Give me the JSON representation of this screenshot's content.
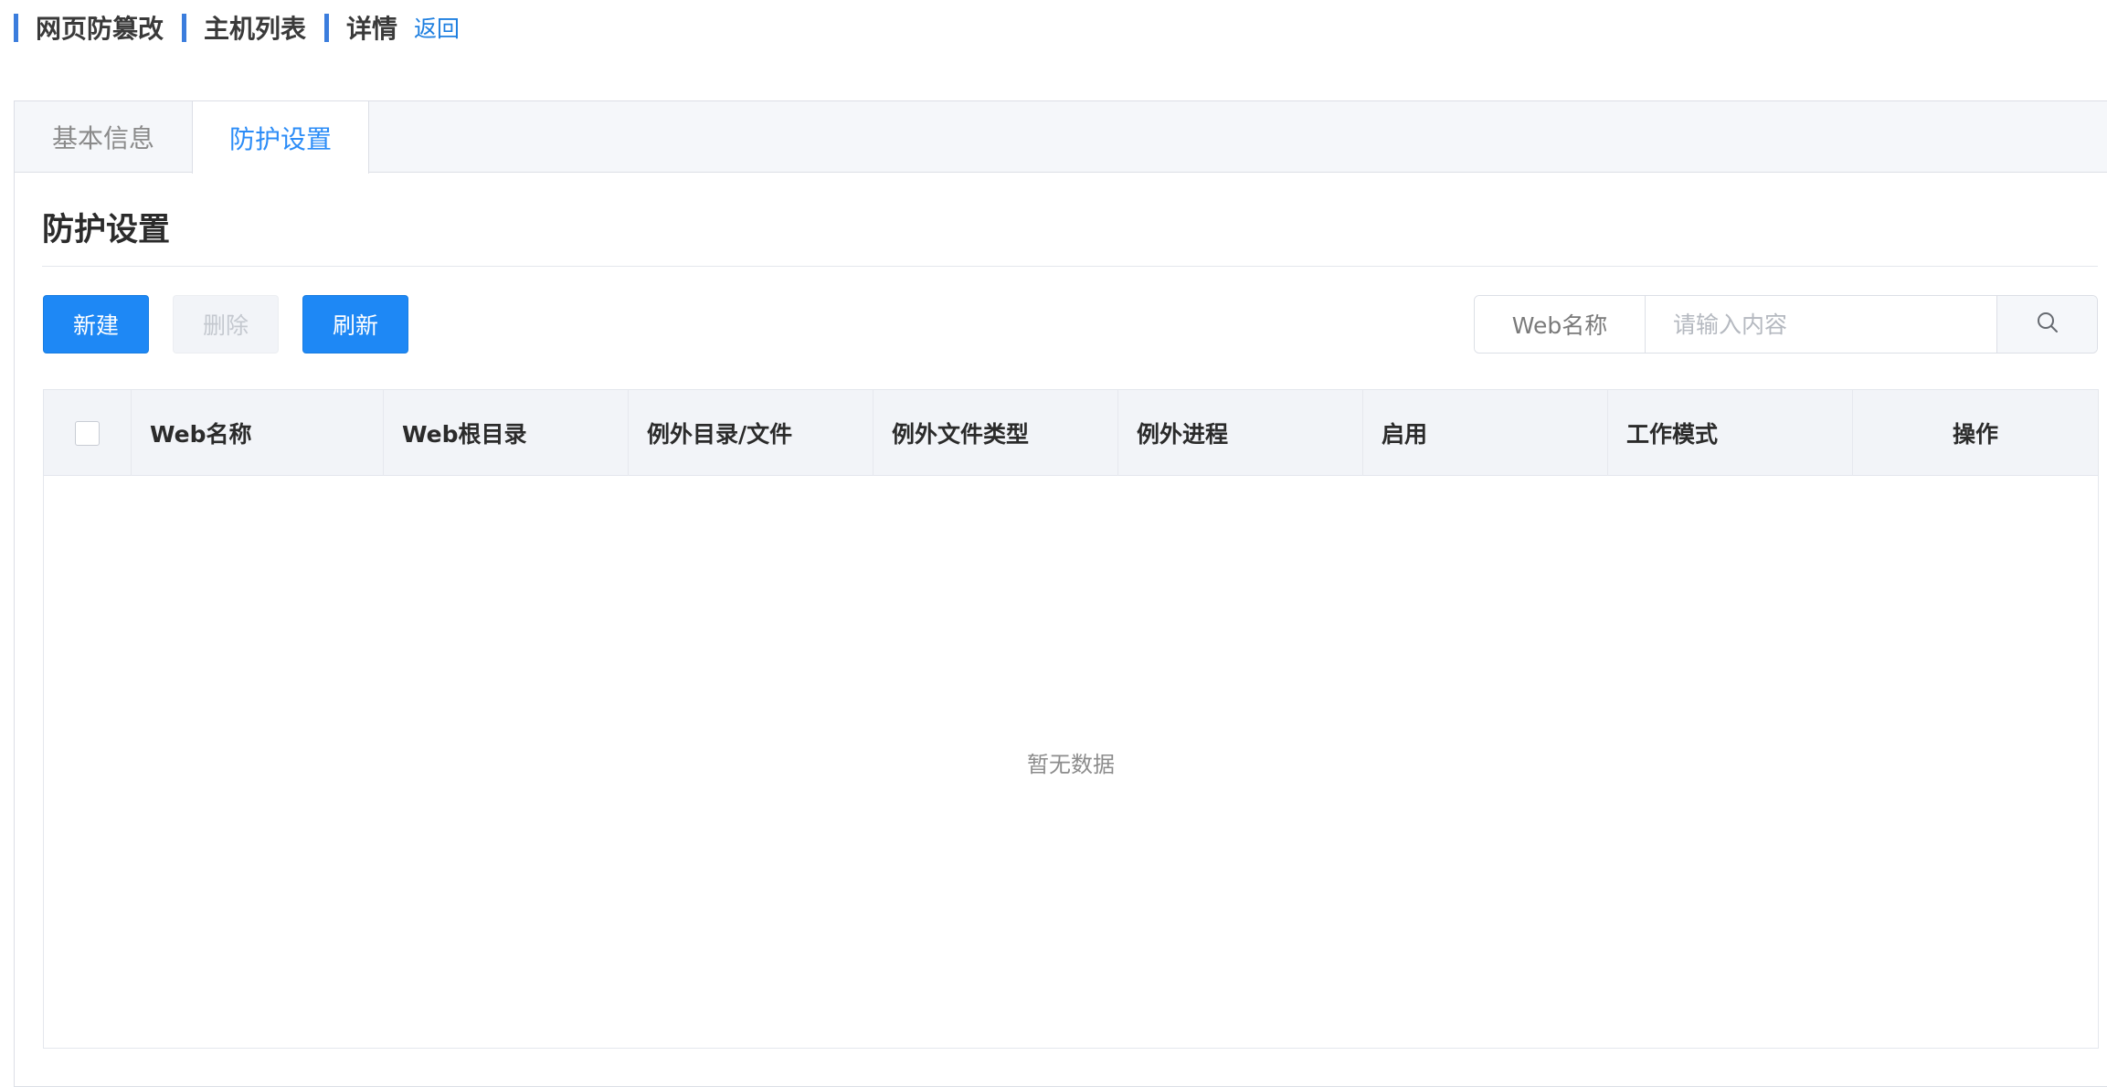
{
  "breadcrumb": {
    "items": [
      "网页防篡改",
      "主机列表",
      "详情"
    ],
    "back": "返回"
  },
  "tabs": {
    "basic": "基本信息",
    "protect": "防护设置",
    "active": "防护设置"
  },
  "section": {
    "title": "防护设置"
  },
  "toolbar": {
    "new_label": "新建",
    "delete_label": "删除",
    "refresh_label": "刷新",
    "delete_disabled": true
  },
  "search": {
    "field_label": "Web名称",
    "placeholder": "请输入内容",
    "value": "",
    "button_icon": "search-icon"
  },
  "table": {
    "columns": [
      "Web名称",
      "Web根目录",
      "例外目录/文件",
      "例外文件类型",
      "例外进程",
      "启用",
      "工作模式",
      "操作"
    ],
    "rows": [],
    "empty_text": "暂无数据"
  },
  "colors": {
    "primary": "#1e88f5",
    "active_tab": "#2b8cf7",
    "breadcrumb_bar": "#3b7ddd",
    "link": "#1e7fe0"
  }
}
